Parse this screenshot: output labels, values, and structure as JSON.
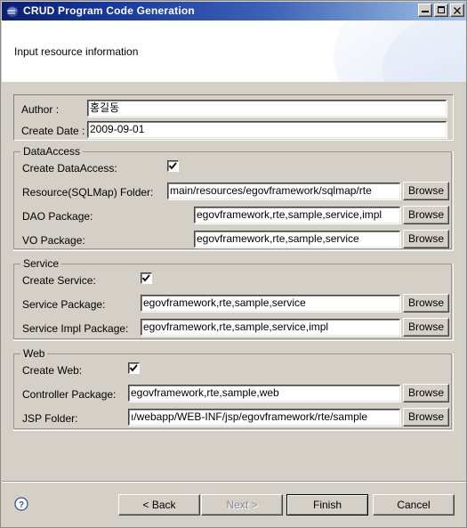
{
  "window": {
    "title": "CRUD Program Code Generation",
    "app_icon": "eclipse-globe-icon",
    "controls": {
      "minimize": "minimize-icon",
      "maximize": "maximize-icon",
      "close": "close-icon"
    }
  },
  "header": {
    "title": "Input resource information"
  },
  "top_panel": {
    "fields": [
      {
        "label": "Author :",
        "value": "홍길동"
      },
      {
        "label": "Create Date :",
        "value": "2009-09-01"
      }
    ]
  },
  "groups": [
    {
      "title": "DataAccess",
      "checkbox": {
        "label": "Create DataAccess:",
        "checked": true
      },
      "rows": [
        {
          "label": "Resource(SQLMap) Folder:",
          "value": "main/resources/egovframework/sqlmap/rte",
          "browse": "Browse"
        },
        {
          "label": "DAO Package:",
          "value": "egovframework,rte,sample,service,impl",
          "browse": "Browse"
        },
        {
          "label": "VO Package:",
          "value": "egovframework,rte,sample,service",
          "browse": "Browse"
        }
      ]
    },
    {
      "title": "Service",
      "checkbox": {
        "label": "Create Service:",
        "checked": true
      },
      "rows": [
        {
          "label": "Service Package:",
          "value": "egovframework,rte,sample,service",
          "browse": "Browse"
        },
        {
          "label": "Service Impl Package:",
          "value": "egovframework,rte,sample,service,impl",
          "browse": "Browse"
        }
      ]
    },
    {
      "title": "Web",
      "checkbox": {
        "label": "Create Web:",
        "checked": true
      },
      "rows": [
        {
          "label": "Controller Package:",
          "value": "egovframework,rte,sample,web",
          "browse": "Browse"
        },
        {
          "label": "JSP Folder:",
          "value": "ı/webapp/WEB-INF/jsp/egovframework/rte/sample",
          "browse": "Browse"
        }
      ]
    }
  ],
  "footer": {
    "help_icon": "help-question-icon",
    "buttons": {
      "back": "< Back",
      "next": "Next >",
      "finish": "Finish",
      "cancel": "Cancel"
    }
  },
  "colors": {
    "dialog_face": "#d4d0c8",
    "title_bar_start": "#0a1f72",
    "title_bar_end": "#a9c2e4",
    "field_bg": "#ffffff",
    "disabled_text": "#868a8e"
  }
}
